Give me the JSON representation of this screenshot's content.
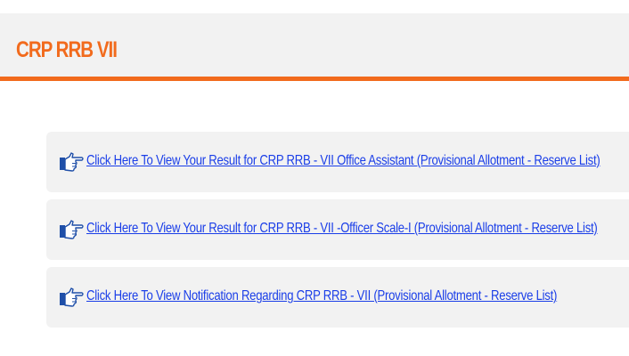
{
  "header": {
    "title": "CRP RRB VII",
    "accent_color": "#f26b1d"
  },
  "links": [
    {
      "icon": "pointing-hand-icon",
      "label": "Click Here To View Your Result for CRP RRB - VII Office Assistant (Provisional Allotment - Reserve List)"
    },
    {
      "icon": "pointing-hand-icon",
      "label": "Click Here To View Your Result for CRP RRB - VII -Officer Scale-I (Provisional Allotment - Reserve List)"
    },
    {
      "icon": "pointing-hand-icon",
      "label": "Click Here To View Notification Regarding CRP RRB - VII (Provisional Allotment - Reserve List)"
    }
  ],
  "colors": {
    "link": "#1a3ee8",
    "panel_background": "#f2f2f2",
    "icon_fill": "#1f4fa8"
  }
}
